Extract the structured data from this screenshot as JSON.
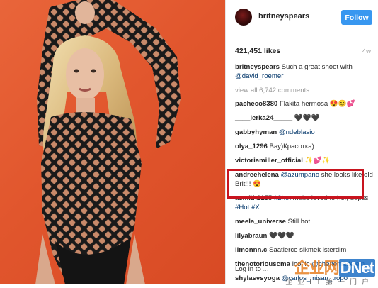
{
  "post": {
    "username": "britneyspears",
    "follow_label": "Follow",
    "likes": "421,451 likes",
    "age": "4w"
  },
  "comments": [
    {
      "user": "britneyspears",
      "text": "Such a great shoot with",
      "mention": "@david_roemer"
    },
    {
      "view_all": "view all 6,742 comments"
    },
    {
      "user": "pacheco8380",
      "text": "Flakita hermosa 😍😊💕"
    },
    {
      "user": "____lerka24_____",
      "text": "🖤🖤🖤"
    },
    {
      "user": "gabbyhyman",
      "text": "",
      "mention": "@ndeblasio"
    },
    {
      "user": "olya_1296",
      "text": "Вау)Красотка)"
    },
    {
      "user": "victoriamiller_official",
      "text": "✨💕✨"
    },
    {
      "user": "andreehelena",
      "mention": "@azumpano",
      "text": "she looks like old Brit!!! 😍"
    },
    {
      "user": "asmith2155",
      "tag1": "#2hot",
      "text": "make loved to her, uupss",
      "tag2": "#Hot",
      "tag3": "#X"
    },
    {
      "user": "meela_universe",
      "text": "Still hot!"
    },
    {
      "user": "lilyabraun",
      "text": "🖤🖤🖤"
    },
    {
      "user": "limonnn.c",
      "text": "Saatlerce sikmek isterdim"
    },
    {
      "user": "thenotoriouscma",
      "text": "Iconic",
      "mention": "@cheriemadelein"
    },
    {
      "user": "shylasvsyoga",
      "mention": "@carlos_misan_tropo"
    }
  ],
  "login": {
    "text": "Log in to",
    "dots": "..."
  },
  "watermark": {
    "main_a": "企业网",
    "main_b": "DNet",
    "sub": "企业IT第一门户"
  },
  "colors": {
    "accent": "#3897f0",
    "highlight": "#c8141e",
    "link": "#003569",
    "background_photo": "#e1562d"
  }
}
